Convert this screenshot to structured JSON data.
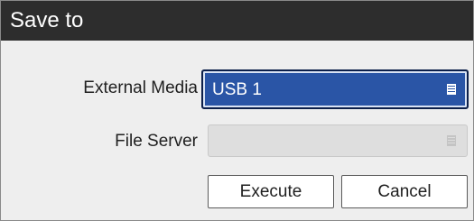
{
  "dialog": {
    "title": "Save to"
  },
  "fields": {
    "external_media": {
      "label": "External Media",
      "value": "USB 1"
    },
    "file_server": {
      "label": "File Server",
      "value": ""
    }
  },
  "buttons": {
    "execute": "Execute",
    "cancel": "Cancel"
  },
  "colors": {
    "titlebar": "#2d2d2d",
    "selected_field": "#2a55a6",
    "dialog_bg": "#eeeeee"
  },
  "icons": {
    "dropdown": "dropdown-list-icon"
  }
}
